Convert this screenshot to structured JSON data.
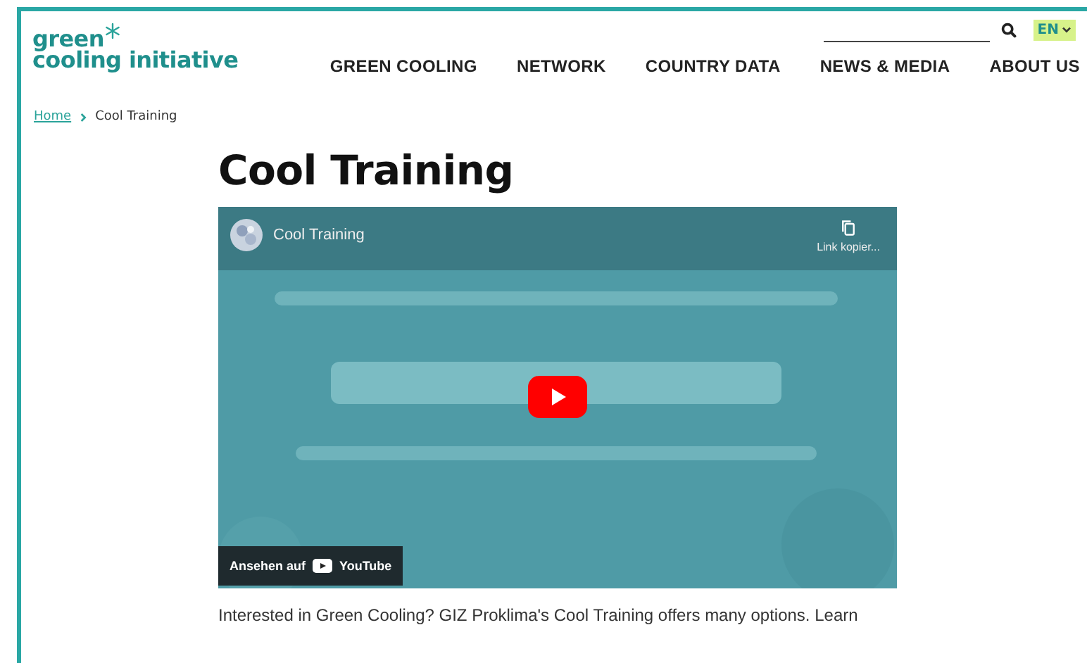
{
  "logo": {
    "line1": "green",
    "line2": "cooling initiative"
  },
  "language": {
    "label": "EN"
  },
  "nav": [
    {
      "label": "GREEN COOLING"
    },
    {
      "label": "NETWORK"
    },
    {
      "label": "COUNTRY DATA"
    },
    {
      "label": "NEWS & MEDIA"
    },
    {
      "label": "ABOUT US"
    }
  ],
  "breadcrumb": [
    {
      "label": "Home",
      "kind": "link"
    },
    {
      "label": "Cool Training",
      "kind": "current"
    }
  ],
  "title": "Cool Training",
  "video": {
    "kind": "picture",
    "title": "Cool Training",
    "copy_label": "Link kopier...",
    "watch_label": "Ansehen auf",
    "platform": "YouTube"
  },
  "intro": "Interested in Green Cooling? GIZ Proklima's Cool Training offers many options. Learn"
}
